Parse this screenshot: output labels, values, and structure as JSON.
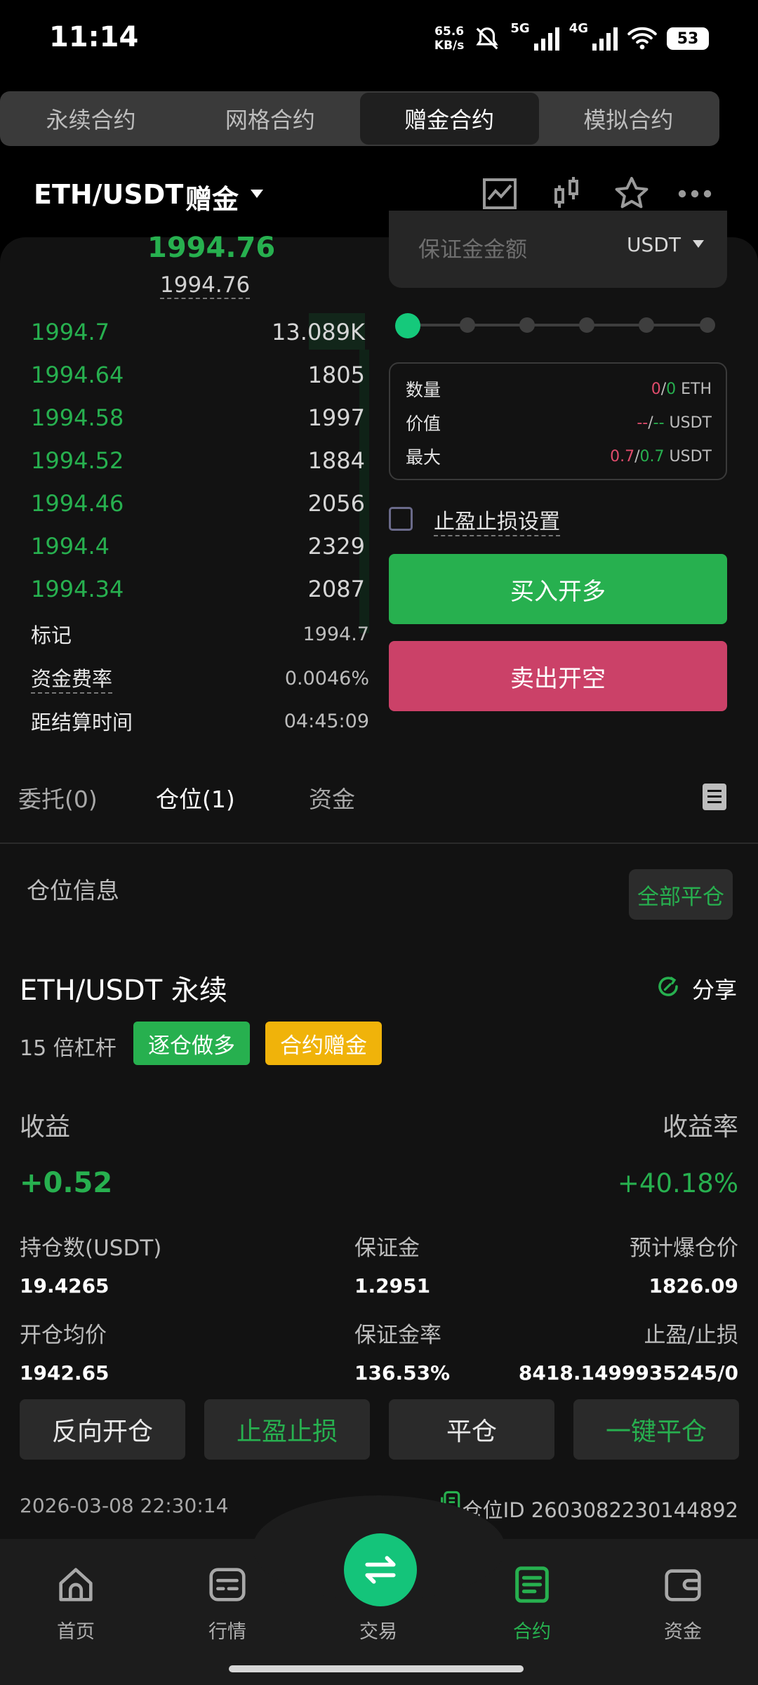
{
  "status": {
    "time": "11:14",
    "speed_value": "65.6",
    "speed_unit": "KB/s",
    "net1": "5G",
    "net2": "4G",
    "battery": "53"
  },
  "top_tabs": [
    {
      "label": "永续合约"
    },
    {
      "label": "网格合约"
    },
    {
      "label": "赠金合约",
      "active": true
    },
    {
      "label": "模拟合约"
    }
  ],
  "header": {
    "pair": "ETH/USDT",
    "mode": "赠金",
    "icons": [
      "chart-line-icon",
      "candlestick-icon",
      "star-icon",
      "more-icon"
    ]
  },
  "order_book": {
    "last_price": "1994.76",
    "mark_price": "1994.76",
    "rows": [
      {
        "price": "1994.7",
        "qty": "13.089K"
      },
      {
        "price": "1994.64",
        "qty": "1805"
      },
      {
        "price": "1994.58",
        "qty": "1997"
      },
      {
        "price": "1994.52",
        "qty": "1884"
      },
      {
        "price": "1994.46",
        "qty": "2056"
      },
      {
        "price": "1994.4",
        "qty": "2329"
      },
      {
        "price": "1994.34",
        "qty": "2087"
      }
    ],
    "info": [
      {
        "label": "标记",
        "value": "1994.7"
      },
      {
        "label": "资金费率",
        "value": "0.0046%"
      },
      {
        "label": "距结算时间",
        "value": "04:45:09"
      }
    ]
  },
  "order_form": {
    "margin_placeholder": "保证金金额",
    "margin_unit": "USDT",
    "slider_fraction": 0,
    "qty": {
      "label": "数量",
      "a": "0",
      "sep": "/",
      "b": "0",
      "unit": " ETH"
    },
    "value": {
      "label": "价值",
      "a": "--",
      "sep": "/",
      "b": "--",
      "unit": " USDT"
    },
    "max": {
      "label": "最大",
      "a": "0.7",
      "sep": "/",
      "b": "0.7",
      "unit": " USDT"
    },
    "tp_sl_label": "止盈止损设置",
    "buy_label": "买入开多",
    "sell_label": "卖出开空"
  },
  "orders_tabs": [
    {
      "label": "委托(0)"
    },
    {
      "label": "仓位(1)",
      "active": true
    },
    {
      "label": "资金"
    }
  ],
  "position": {
    "section_title": "仓位信息",
    "close_all": "全部平仓",
    "symbol": "ETH/USDT 永续",
    "share": "分享",
    "leverage": "15 倍杠杆",
    "tag_side": "逐仓做多",
    "tag_bonus": "合约赠金",
    "pnl_label": "收益",
    "roe_label": "收益率",
    "pnl": "+0.52",
    "roe": "+40.18%",
    "fields": [
      {
        "label": "持仓数(USDT)",
        "value": "19.4265"
      },
      {
        "label": "保证金",
        "value": "1.2951"
      },
      {
        "label": "预计爆仓价",
        "value": "1826.09"
      },
      {
        "label": "开仓均价",
        "value": "1942.65"
      },
      {
        "label": "保证金率",
        "value": "136.53%"
      },
      {
        "label": "止盈/止损",
        "value": "8418.1499935245/0"
      }
    ],
    "actions": [
      "反向开仓",
      "止盈止损",
      "平仓",
      "一键平仓"
    ],
    "time": "2026-03-08 22:30:14",
    "id": "仓位ID 2603082230144892"
  },
  "nav": {
    "items": [
      {
        "label": "首页"
      },
      {
        "label": "行情"
      },
      {
        "label": "交易"
      },
      {
        "label": "合约",
        "active": true
      },
      {
        "label": "资金"
      }
    ]
  },
  "colors": {
    "green": "#27b04f",
    "red": "#cb4168",
    "accent": "#14c47a",
    "yellow": "#f0b30a"
  }
}
